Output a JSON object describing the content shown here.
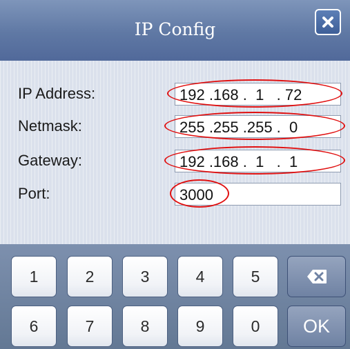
{
  "window": {
    "title": "IP Config"
  },
  "form": {
    "fields": [
      {
        "label": "IP Address:",
        "value": "192 .168 .  1   . 72"
      },
      {
        "label": "Netmask:",
        "value": "255 .255 .255 .  0"
      },
      {
        "label": "Gateway:",
        "value": "192 .168 .  1   .  1"
      },
      {
        "label": "Port:",
        "value": "3000"
      }
    ]
  },
  "keypad": {
    "keys": [
      "1",
      "2",
      "3",
      "4",
      "5",
      "6",
      "7",
      "8",
      "9",
      "0"
    ],
    "ok_label": "OK",
    "backspace_icon": "backspace-icon"
  },
  "annotations": {
    "color": "#e01010"
  },
  "colors": {
    "titlebar": "#5f78a4",
    "form_bg": "#dbe1ec",
    "keypad_bg": "#6f82a3"
  }
}
